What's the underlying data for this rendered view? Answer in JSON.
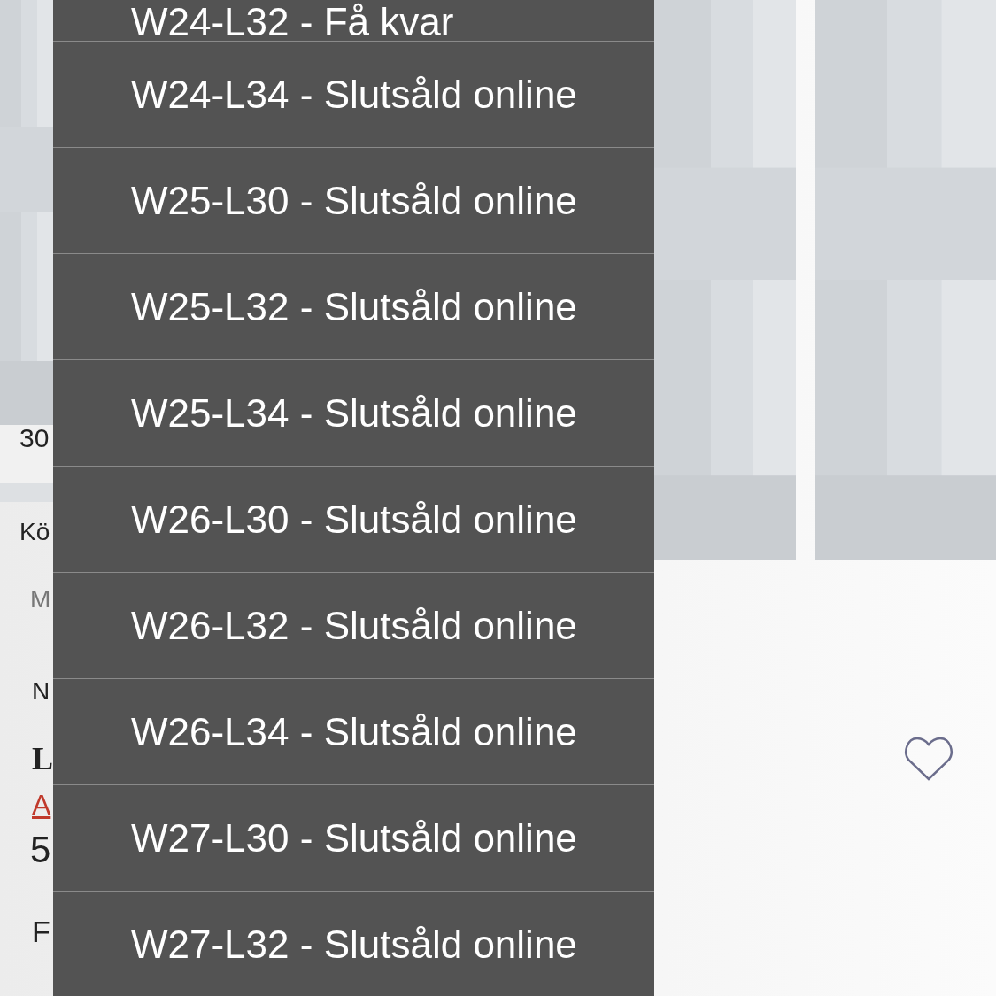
{
  "page": {
    "left_texts": [
      {
        "kind": "size",
        "text": "30"
      },
      {
        "kind": "label",
        "text": "Kö"
      },
      {
        "kind": "muted",
        "text": "M"
      },
      {
        "kind": "plain",
        "text": "N"
      },
      {
        "kind": "title",
        "text": "L"
      },
      {
        "kind": "link",
        "text": "A"
      },
      {
        "kind": "price",
        "text": "5"
      },
      {
        "kind": "plain2",
        "text": "F"
      }
    ],
    "favorite": {
      "on": false
    }
  },
  "menu": {
    "items": [
      {
        "label": "W24-L32 - Få kvar"
      },
      {
        "label": "W24-L34 - Slutsåld online"
      },
      {
        "label": "W25-L30 - Slutsåld online"
      },
      {
        "label": "W25-L32 - Slutsåld online"
      },
      {
        "label": "W25-L34 - Slutsåld online"
      },
      {
        "label": "W26-L30 - Slutsåld online"
      },
      {
        "label": "W26-L32 - Slutsåld online"
      },
      {
        "label": "W26-L34 - Slutsåld online"
      },
      {
        "label": "W27-L30 - Slutsåld online"
      },
      {
        "label": "W27-L32 - Slutsåld online"
      }
    ]
  }
}
